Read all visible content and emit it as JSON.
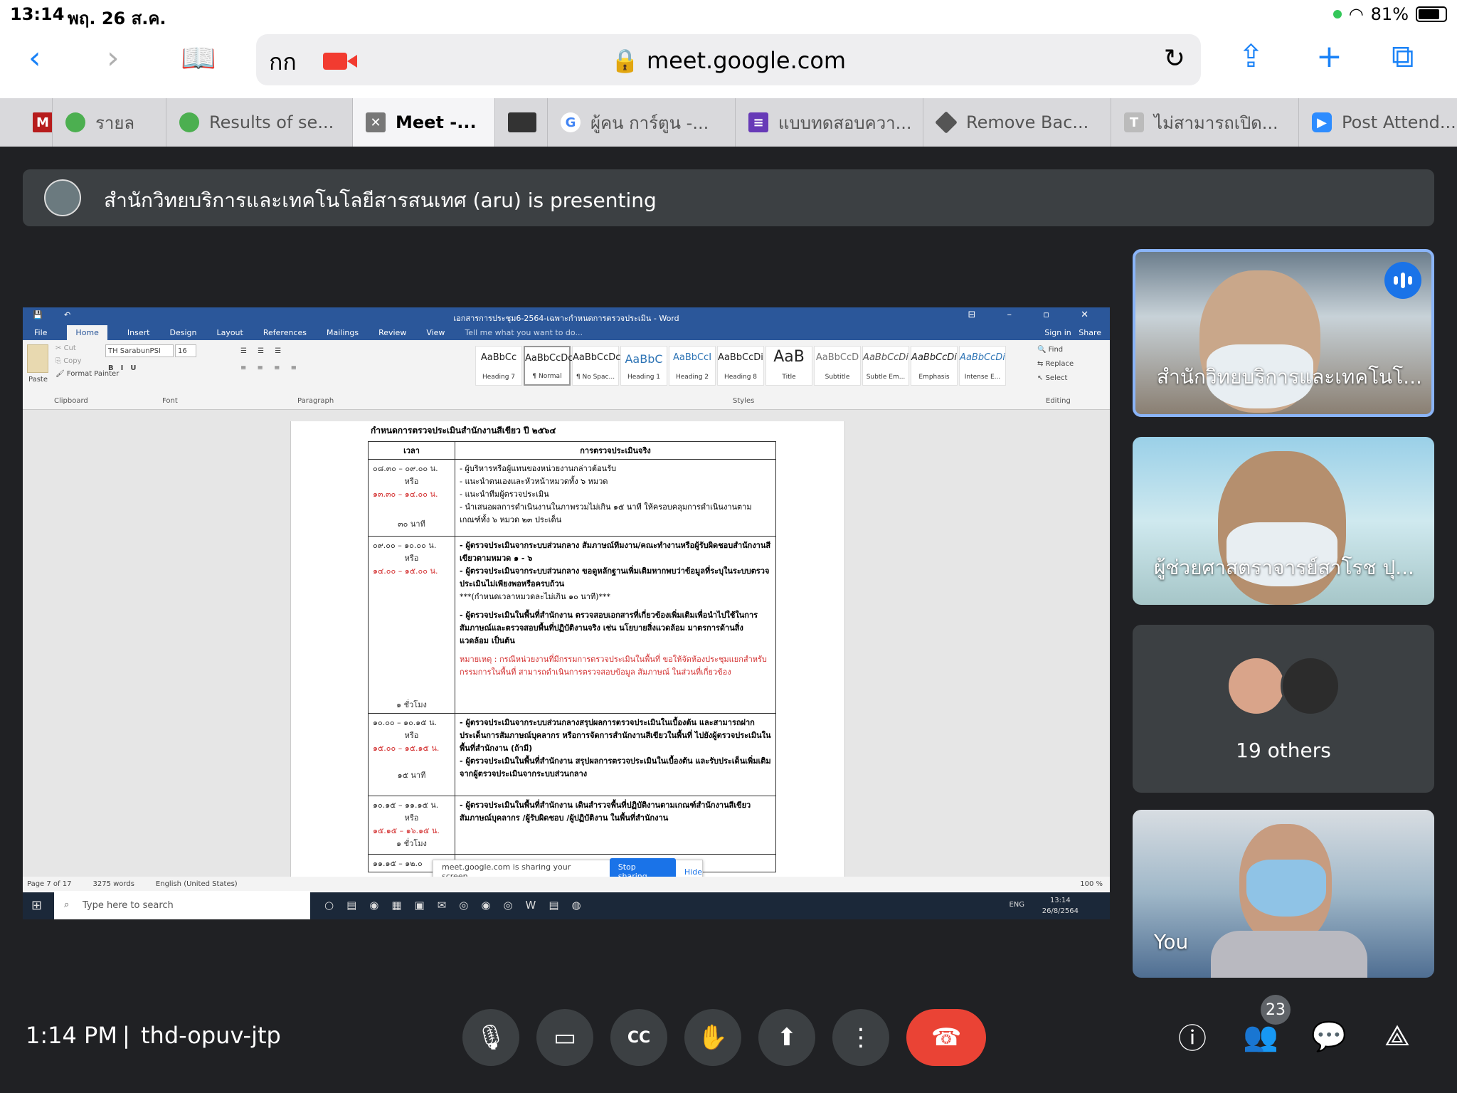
{
  "status_bar": {
    "time": "13:14",
    "date": "พฤ. 26 ส.ค.",
    "battery": "81%"
  },
  "browser": {
    "text_size_label": "กก",
    "url": "meet.google.com",
    "tabs": [
      {
        "label": "",
        "icon": "gmail-icon",
        "color": "#b71c1c"
      },
      {
        "label": "รายล",
        "icon": "seal-icon",
        "color": "#4caf50"
      },
      {
        "label": "Results of se...",
        "icon": "seal-icon",
        "color": "#4caf50"
      },
      {
        "label": "Meet -...",
        "icon": "close-icon",
        "color": "#555555",
        "active": true
      },
      {
        "label": "",
        "icon": "camera-icon",
        "color": "#333333"
      },
      {
        "label": "ผู้คน การ์ตูน -...",
        "icon": "google-icon",
        "color": "#4285f4"
      },
      {
        "label": "แบบทดสอบควา...",
        "icon": "forms-icon",
        "color": "#673ab7"
      },
      {
        "label": "Remove Bac...",
        "icon": "layers-icon",
        "color": "#555555"
      },
      {
        "label": "ไม่สามารถเปิด...",
        "icon": "letter-t-icon",
        "color": "#bbbbbb"
      },
      {
        "label": "Post Attend...",
        "icon": "zoom-icon",
        "color": "#2d8cff"
      }
    ]
  },
  "meet": {
    "presenting_banner": "สำนักวิทยบริการและเทคโนโลยีสารสนเทศ (aru) is presenting",
    "meeting_time": "1:14 PM",
    "meeting_code": "thd-opuv-jtp",
    "participant_count": "23",
    "participants": [
      {
        "name": "สำนักวิทยบริการและเทคโนโ...",
        "speaking": true
      },
      {
        "name": "ผู้ช่วยศาสตราจารย์สาโรช ปุ..."
      },
      {
        "others_label": "19 others"
      },
      {
        "name": "You"
      }
    ],
    "colors": {
      "end_call": "#ea4335",
      "speaking_ring": "#8ab4f8",
      "background": "#202124"
    }
  },
  "word": {
    "title": "เอกสารการประชุม6-2564-เฉพาะกำหนดการตรวจประเมิน - Word",
    "menu": [
      "File",
      "Home",
      "Insert",
      "Design",
      "Layout",
      "References",
      "Mailings",
      "Review",
      "View"
    ],
    "tell_me": "Tell me what you want to do...",
    "sign_in": "Sign in",
    "share": "Share",
    "font_name": "TH SarabunPSI",
    "font_size": "16",
    "clipboard": {
      "paste": "Paste",
      "cut": "Cut",
      "copy": "Copy",
      "format_painter": "Format Painter",
      "label": "Clipboard"
    },
    "groups": {
      "font": "Font",
      "paragraph": "Paragraph",
      "styles": "Styles",
      "editing": "Editing"
    },
    "editing": {
      "find": "Find",
      "replace": "Replace",
      "select": "Select"
    },
    "styles": [
      {
        "sample": "AaBbCc",
        "name": "Heading 7"
      },
      {
        "sample": "AaBbCcDc",
        "name": "¶ Normal"
      },
      {
        "sample": "AaBbCcDc",
        "name": "¶ No Spac..."
      },
      {
        "sample": "AaBbC",
        "name": "Heading 1"
      },
      {
        "sample": "AaBbCcI",
        "name": "Heading 2"
      },
      {
        "sample": "AaBbCcDi",
        "name": "Heading 8"
      },
      {
        "sample": "AaB",
        "name": "Title"
      },
      {
        "sample": "AaBbCcD",
        "name": "Subtitle"
      },
      {
        "sample": "AaBbCcDi",
        "name": "Subtle Em..."
      },
      {
        "sample": "AaBbCcDi",
        "name": "Emphasis"
      },
      {
        "sample": "AaBbCcDi",
        "name": "Intense E..."
      }
    ],
    "doc_heading": "กำหนดการตรวจประเมินสำนักงานสีเขียว ปี ๒๕๖๔",
    "table_headers": [
      "เวลา",
      "การตรวจประเมินจริง"
    ],
    "table_rows": [
      {
        "time": "๐๘.๓๐ – ๐๙.๐๐ น.",
        "or": "หรือ",
        "time_alt": "๑๓.๓๐ – ๑๔.๐๐ น.",
        "duration": "๓๐ นาที",
        "items": [
          "- ผู้บริหารหรือผู้แทนของหน่วยงานกล่าวต้อนรับ",
          "- แนะนำตนเองและหัวหน้าหมวดทั้ง ๖ หมวด",
          "- แนะนำทีมผู้ตรวจประเมิน",
          "- นำเสนอผลการดำเนินงานในภาพรวมไม่เกิน ๑๕ นาที ให้ครอบคลุมการดำเนินงานตามเกณฑ์ทั้ง ๖ หมวด ๒๓ ประเด็น"
        ]
      },
      {
        "time": "๐๙.๐๐ – ๑๐.๐๐ น.",
        "or": "หรือ",
        "time_alt": "๑๔.๐๐ – ๑๕.๐๐ น.",
        "duration": "๑ ชั่วโมง",
        "items": [
          "- ผู้ตรวจประเมินจากระบบส่วนกลาง สัมภาษณ์ทีมงาน/คณะทำงานหรือผู้รับผิดชอบสำนักงานสีเขียวตามหมวด ๑ - ๖",
          "- ผู้ตรวจประเมินจากระบบส่วนกลาง ขอดูหลักฐานเพิ่มเติมหากพบว่าข้อมูลที่ระบุในระบบตรวจประเมินไม่เพียงพอหรือครบถ้วน",
          "***(กำหนดเวลาหมวดละไม่เกิน ๑๐ นาที)***",
          "- ผู้ตรวจประเมินในพื้นที่สำนักงาน ตรวจสอบเอกสารที่เกี่ยวข้องเพิ่มเติมเพื่อนำไปใช้ในการสัมภาษณ์และตรวจสอบพื้นที่ปฏิบัติงานจริง เช่น นโยบายสิ่งแวดล้อม มาตรการด้านสิ่งแวดล้อม เป็นต้น"
        ],
        "note": "หมายเหตุ : กรณีหน่วยงานที่มีกรรมการตรวจประเมินในพื้นที่ ขอให้จัดห้องประชุมแยกสำหรับกรรมการในพื้นที่ สามารถดำเนินการตรวจสอบข้อมูล สัมภาษณ์ ในส่วนที่เกี่ยวข้อง"
      },
      {
        "time": "๑๐.๐๐ – ๑๐.๑๕ น.",
        "or": "หรือ",
        "time_alt": "๑๕.๐๐ – ๑๕.๑๕ น.",
        "duration": "๑๕ นาที",
        "items": [
          "- ผู้ตรวจประเมินจากระบบส่วนกลางสรุปผลการตรวจประเมินในเบื้องต้น และสามารถฝากประเด็นการสัมภาษณ์บุคลากร หรือการจัดการสำนักงานสีเขียวในพื้นที่ ไปยังผู้ตรวจประเมินในพื้นที่สำนักงาน (ถ้ามี)",
          "- ผู้ตรวจประเมินในพื้นที่สำนักงาน สรุปผลการตรวจประเมินในเบื้องต้น และรับประเด็นเพิ่มเติมจากผู้ตรวจประเมินจากระบบส่วนกลาง"
        ]
      },
      {
        "time": "๑๐.๑๕ – ๑๑.๑๕ น.",
        "or": "หรือ",
        "time_alt": "๑๕.๑๕ – ๑๖.๑๕ น.",
        "duration": "๑ ชั่วโมง",
        "items": [
          "- ผู้ตรวจประเมินในพื้นที่สำนักงาน เดินสำรวจพื้นที่ปฏิบัติงานตามเกณฑ์สำนักงานสีเขียว สัมภาษณ์บุคลากร /ผู้รับผิดชอบ /ผู้ปฏิบัติงาน ในพื้นที่สำนักงาน"
        ]
      }
    ],
    "last_row_time": "๑๑.๑๕ – ๑๒.๐",
    "sharing_text": "meet.google.com is sharing your screen.",
    "stop_sharing": "Stop sharing",
    "hide": "Hide",
    "status": {
      "page": "Page 7 of 17",
      "words": "3275 words",
      "language": "English (United States)",
      "zoom": "100 %"
    },
    "taskbar": {
      "search_placeholder": "Type here to search",
      "lang": "ENG",
      "time": "13:14",
      "date": "26/8/2564"
    }
  }
}
